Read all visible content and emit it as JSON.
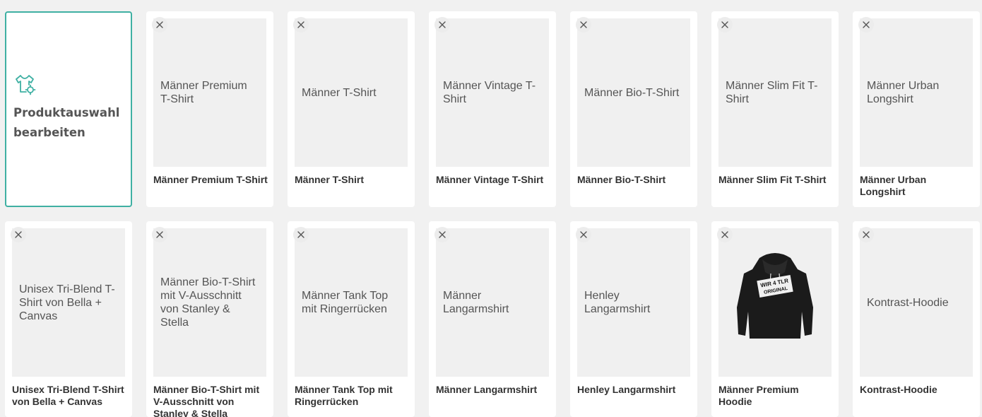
{
  "edit_card": {
    "label": "Produktauswahl bearbeiten",
    "icon": "tshirt-gear-icon",
    "accent_color": "#3fb0a3"
  },
  "products": [
    {
      "name": "Männer Premium T-Shirt",
      "image_alt": "Männer Premium T-Shirt"
    },
    {
      "name": "Männer T-Shirt",
      "image_alt": "Männer T-Shirt"
    },
    {
      "name": "Männer Vintage T-Shirt",
      "image_alt": "Männer Vintage T-Shirt"
    },
    {
      "name": "Männer Bio-T-Shirt",
      "image_alt": "Männer Bio-T-Shirt"
    },
    {
      "name": "Männer Slim Fit T-Shirt",
      "image_alt": "Männer Slim Fit T-Shirt"
    },
    {
      "name": "Männer Urban Longshirt",
      "image_alt": "Männer Urban Longshirt"
    },
    {
      "name": "Unisex Tri-Blend T-Shirt von Bella + Canvas",
      "image_alt": "Unisex Tri-Blend T-Shirt von Bella + Canvas"
    },
    {
      "name": "Männer Bio-T-Shirt mit V-Ausschnitt von Stanley & Stella",
      "image_alt": "Männer Bio-T-Shirt mit V-Ausschnitt von Stanley & Stella"
    },
    {
      "name": "Männer Tank Top mit Ringerrücken",
      "image_alt": "Männer Tank Top mit Ringerrücken"
    },
    {
      "name": "Männer Langarmshirt",
      "image_alt": "Männer Langarmshirt"
    },
    {
      "name": "Henley Langarmshirt",
      "image_alt": "Henley Langarmshirt"
    },
    {
      "name": "Männer Premium Hoodie",
      "image_alt": "",
      "image": "hoodie",
      "print_text": [
        "WIR 4 TLR",
        "ORIGINAL"
      ]
    },
    {
      "name": "Kontrast-Hoodie",
      "image_alt": "Kontrast-Hoodie"
    }
  ],
  "remove_icon": "close-icon"
}
